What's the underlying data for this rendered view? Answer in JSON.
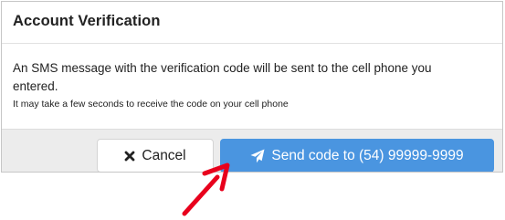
{
  "dialog": {
    "title": "Account Verification",
    "message": "An SMS message with the verification code will be sent to the cell phone you entered.",
    "note": "It may take a few seconds to receive the code on your cell phone"
  },
  "footer": {
    "cancel_label": "Cancel",
    "send_label": "Send code to (54) 99999-9999"
  },
  "icons": {
    "cancel": "close-icon",
    "send": "paper-plane-icon",
    "annotation": "red-arrow-icon"
  },
  "colors": {
    "send_button": "#4a95e0",
    "footer_bg": "#ececec",
    "annotation_arrow": "#e8001c"
  }
}
